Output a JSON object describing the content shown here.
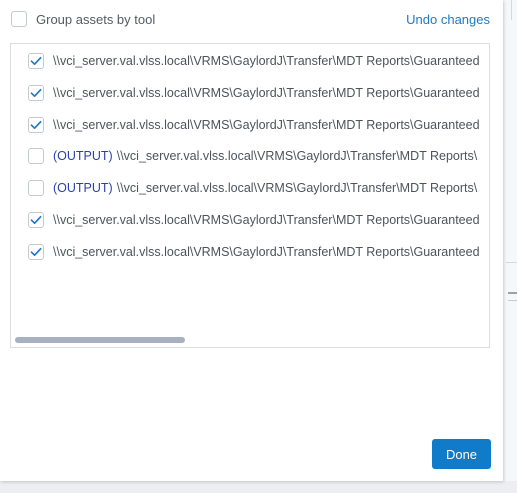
{
  "header": {
    "group_label": "Group assets by tool",
    "group_checked": false,
    "undo_label": "Undo changes"
  },
  "assets": [
    {
      "checked": true,
      "prefix": "",
      "path": "\\\\vci_server.val.vlss.local\\VRMS\\GaylordJ\\Transfer\\MDT Reports\\Guaranteed"
    },
    {
      "checked": true,
      "prefix": "",
      "path": "\\\\vci_server.val.vlss.local\\VRMS\\GaylordJ\\Transfer\\MDT Reports\\Guaranteed"
    },
    {
      "checked": true,
      "prefix": "",
      "path": "\\\\vci_server.val.vlss.local\\VRMS\\GaylordJ\\Transfer\\MDT Reports\\Guaranteed"
    },
    {
      "checked": false,
      "prefix": "(OUTPUT)",
      "path": "\\\\vci_server.val.vlss.local\\VRMS\\GaylordJ\\Transfer\\MDT Reports\\"
    },
    {
      "checked": false,
      "prefix": "(OUTPUT)",
      "path": "\\\\vci_server.val.vlss.local\\VRMS\\GaylordJ\\Transfer\\MDT Reports\\"
    },
    {
      "checked": true,
      "prefix": "",
      "path": "\\\\vci_server.val.vlss.local\\VRMS\\GaylordJ\\Transfer\\MDT Reports\\Guaranteed"
    },
    {
      "checked": true,
      "prefix": "",
      "path": "\\\\vci_server.val.vlss.local\\VRMS\\GaylordJ\\Transfer\\MDT Reports\\Guaranteed"
    }
  ],
  "footer": {
    "done_label": "Done"
  },
  "colors": {
    "accent": "#0f7bc9",
    "link": "#1f79c4",
    "output_tag": "#2a3fb0",
    "check": "#1f7ac4"
  }
}
